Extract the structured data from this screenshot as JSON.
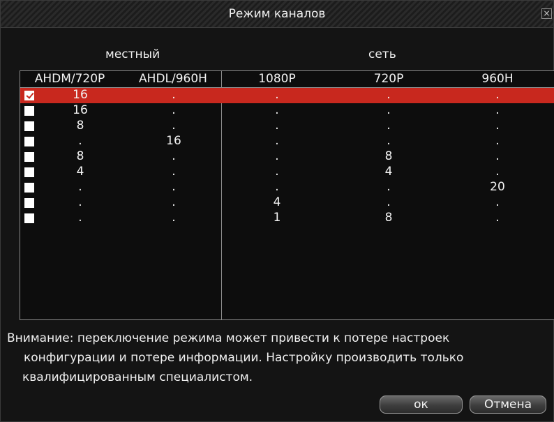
{
  "dialog": {
    "title": "Режим каналов",
    "close_label": "×"
  },
  "groups": {
    "local": "местный",
    "network": "сеть"
  },
  "columns": [
    "AHDM/720P",
    "AHDL/960H",
    "1080P",
    "720P",
    "960H"
  ],
  "rows": [
    {
      "checked": true,
      "selected": true,
      "cells": [
        "16",
        ".",
        ".",
        ".",
        "."
      ]
    },
    {
      "checked": false,
      "selected": false,
      "cells": [
        "16",
        ".",
        ".",
        ".",
        "."
      ]
    },
    {
      "checked": false,
      "selected": false,
      "cells": [
        "8",
        ".",
        ".",
        ".",
        "."
      ]
    },
    {
      "checked": false,
      "selected": false,
      "cells": [
        ".",
        "16",
        ".",
        ".",
        "."
      ]
    },
    {
      "checked": false,
      "selected": false,
      "cells": [
        "8",
        ".",
        ".",
        "8",
        "."
      ]
    },
    {
      "checked": false,
      "selected": false,
      "cells": [
        "4",
        ".",
        ".",
        "4",
        "."
      ]
    },
    {
      "checked": false,
      "selected": false,
      "cells": [
        ".",
        ".",
        ".",
        ".",
        "20"
      ]
    },
    {
      "checked": false,
      "selected": false,
      "cells": [
        ".",
        ".",
        "4",
        ".",
        "."
      ]
    },
    {
      "checked": false,
      "selected": false,
      "cells": [
        ".",
        ".",
        "1",
        "8",
        "."
      ]
    }
  ],
  "notice": {
    "line1": "Внимание: переключение режима может привести к потере настроек",
    "line2": "конфигурации и потере информации. Настройку производить только",
    "line3": "квалифицированным специалистом."
  },
  "buttons": {
    "ok": "ок",
    "cancel": "Отмена"
  },
  "colors": {
    "selected_row": "#c8281e",
    "background": "#141414"
  }
}
